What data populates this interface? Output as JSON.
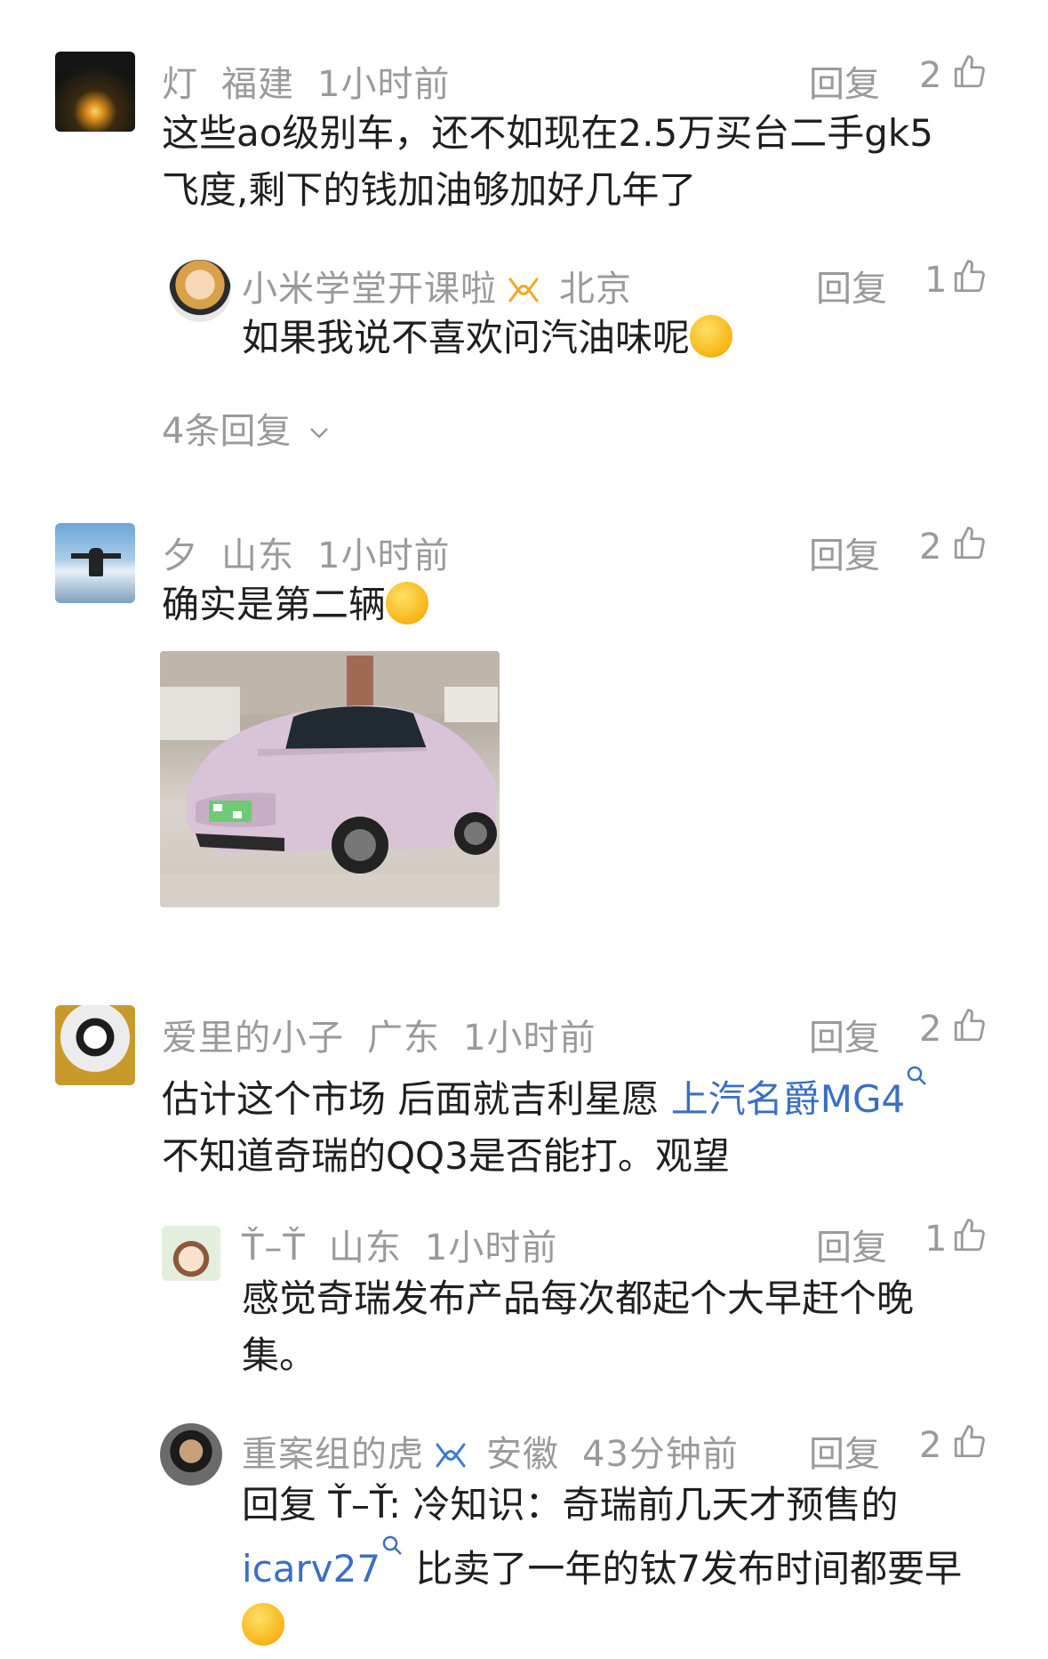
{
  "comments": [
    {
      "user": "灯",
      "location": "福建",
      "time": "1小时前",
      "reply_label": "回复",
      "likes": "2",
      "text_lines": [
        "这些ao级别车，还不如现在2.5万买台二手gk5",
        "飞度,剩下的钱加油够加好几年了"
      ],
      "sub_replies": [
        {
          "user": "小米学堂开课啦",
          "location": "北京",
          "reply_label": "回复",
          "likes": "1",
          "text": "如果我说不喜欢问汽油味呢"
        }
      ],
      "more_replies": "4条回复"
    },
    {
      "user": "夕",
      "location": "山东",
      "time": "1小时前",
      "reply_label": "回复",
      "likes": "2",
      "text": "确实是第二辆",
      "image_alt": "pink electric hatchback car"
    },
    {
      "user": "爱里的小子",
      "location": "广东",
      "time": "1小时前",
      "reply_label": "回复",
      "likes": "2",
      "text_pre": "估计这个市场 后面就吉利星愿 ",
      "link": "上汽名爵MG4",
      "text_line2": " 不知道奇瑞的QQ3是否能打。观望",
      "sub_replies": [
        {
          "user": "Ť–Ť",
          "location": "山东",
          "time": "1小时前",
          "reply_label": "回复",
          "likes": "1",
          "text_lines": [
            "感觉奇瑞发布产品每次都起个大早赶个晚",
            "集。"
          ]
        },
        {
          "user": "重案组的虎",
          "location": "安徽",
          "time": "43分钟前",
          "reply_label": "回复",
          "likes": "2",
          "line1": "回复 Ť–Ť: 冷知识：奇瑞前几天才预售的",
          "link": "icarv27",
          "line2_rest": " 比卖了一年的钛7发布时间都要早"
        }
      ]
    }
  ],
  "colors": {
    "meta": "#9a9a9a",
    "link": "#3a6fc4",
    "text": "#1f1f1f"
  }
}
